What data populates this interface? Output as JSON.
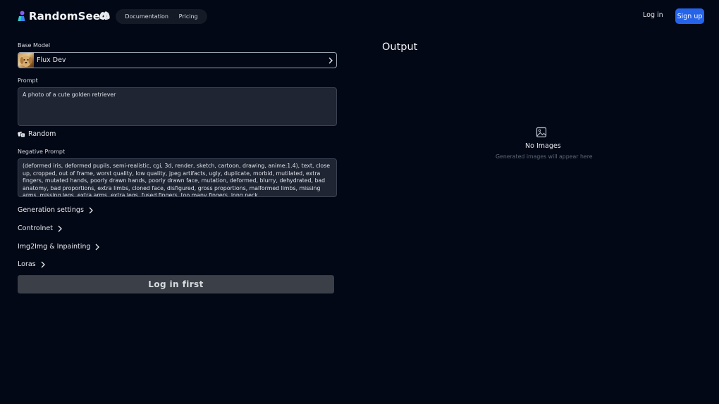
{
  "header": {
    "brand": "RandomSeed",
    "nav": [
      "Documentation",
      "Pricing"
    ],
    "login": "Log in",
    "signup": "Sign up"
  },
  "form": {
    "base_model_label": "Base Model",
    "base_model_value": "Flux Dev",
    "prompt_label": "Prompt",
    "prompt_value": "A photo of a cute golden retriever",
    "random_label": "Random",
    "negative_label": "Negative Prompt",
    "negative_value": "(deformed iris, deformed pupils, semi-realistic, cgi, 3d, render, sketch, cartoon, drawing, anime:1.4), text, close up, cropped, out of frame, worst quality, low quality, jpeg artifacts, ugly, duplicate, morbid, mutilated, extra fingers, mutated hands, poorly drawn hands, poorly drawn face, mutation, deformed, blurry, dehydrated, bad anatomy, bad proportions, extra limbs, cloned face, disfigured, gross proportions, malformed limbs, missing arms, missing legs, extra arms, extra legs, fused fingers, too many fingers, long neck",
    "sections": [
      "Generation settings",
      "Controlnet",
      "Img2Img & Inpainting",
      "Loras"
    ],
    "submit": "Log in first"
  },
  "output": {
    "title": "Output",
    "empty_title": "No Images",
    "empty_subtitle": "Generated images will appear here"
  },
  "colors": {
    "background": "#030816",
    "accent": "#2563eb",
    "field": "#1f2533",
    "button_disabled": "#3a3f48"
  },
  "icons": [
    "logo-icon",
    "discord-icon",
    "chevron-right-icon",
    "dice-icon",
    "image-icon"
  ]
}
